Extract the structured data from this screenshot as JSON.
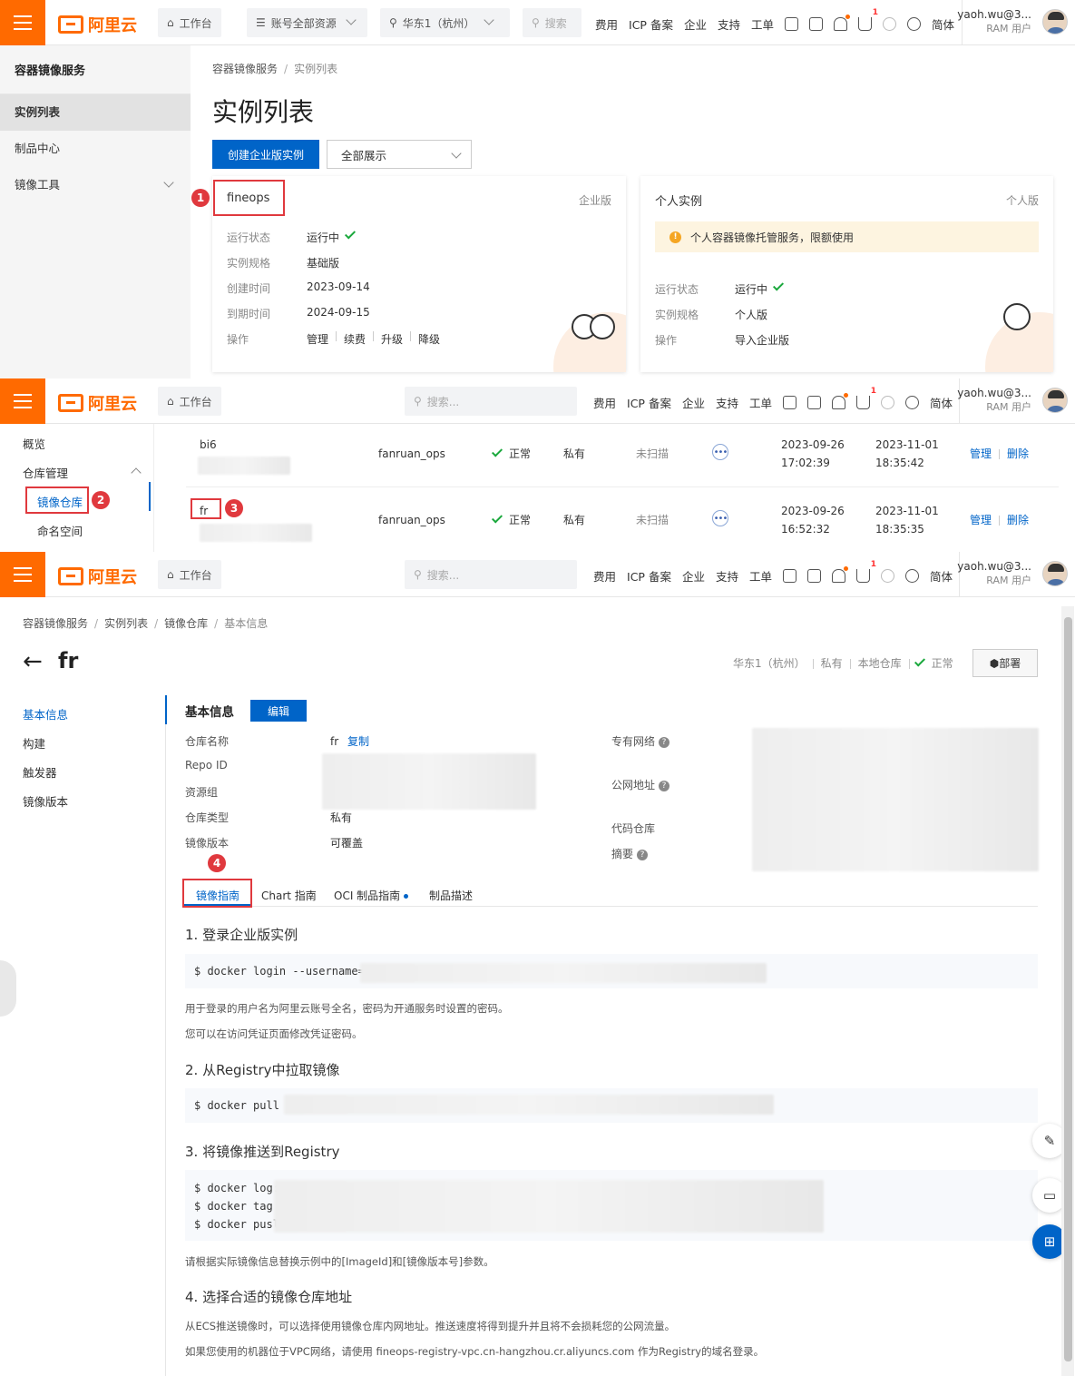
{
  "topbar": {
    "logo": "阿里云",
    "workbench": "工作台",
    "resources": "账号全部资源",
    "region": "华东1（杭州）",
    "search_short": "搜索",
    "search": "搜索...",
    "nav": [
      "费用",
      "ICP 备案",
      "企业",
      "支持",
      "工单"
    ],
    "lang": "简体",
    "cart_badge": "1",
    "user": "yaoh.wu@3...",
    "role": "RAM 用户"
  },
  "s1": {
    "sidebar_title": "容器镜像服务",
    "sidebar_items": [
      "实例列表",
      "制品中心",
      "镜像工具"
    ],
    "breadcrumb": [
      "容器镜像服务",
      "实例列表"
    ],
    "title": "实例列表",
    "create_button": "创建企业版实例",
    "filter": "全部展示",
    "card1": {
      "name": "fineops",
      "tag": "企业版",
      "rows": [
        {
          "k": "运行状态",
          "v": "运行中"
        },
        {
          "k": "实例规格",
          "v": "基础版"
        },
        {
          "k": "创建时间",
          "v": "2023-09-14"
        },
        {
          "k": "到期时间",
          "v": "2024-09-15"
        },
        {
          "k": "操作"
        }
      ],
      "actions": [
        "管理",
        "续费",
        "升级",
        "降级"
      ]
    },
    "card2": {
      "name": "个人实例",
      "tag": "个人版",
      "notice": "个人容器镜像托管服务，限额使用",
      "rows": [
        {
          "k": "运行状态",
          "v": "运行中"
        },
        {
          "k": "实例规格",
          "v": "个人版"
        },
        {
          "k": "操作",
          "v": "导入企业版"
        }
      ]
    }
  },
  "s2": {
    "side_items": [
      "概览",
      "仓库管理",
      "镜像仓库",
      "命名空间"
    ],
    "rows": [
      {
        "name": "bi6",
        "ns": "fanruan_ops",
        "status": "正常",
        "type": "私有",
        "scan": "未扫描",
        "created": [
          "2023-09-26",
          "17:02:39"
        ],
        "updated": [
          "2023-11-01",
          "18:35:42"
        ]
      },
      {
        "name": "fr",
        "ns": "fanruan_ops",
        "status": "正常",
        "type": "私有",
        "scan": "未扫描",
        "created": [
          "2023-09-26",
          "16:52:32"
        ],
        "updated": [
          "2023-11-01",
          "18:35:35"
        ]
      }
    ],
    "actions": [
      "管理",
      "删除"
    ]
  },
  "s3": {
    "breadcrumb": [
      "容器镜像服务",
      "实例列表",
      "镜像仓库",
      "基本信息"
    ],
    "title": "fr",
    "meta": [
      "华东1（杭州）",
      "私有",
      "本地仓库",
      "正常"
    ],
    "deploy": "部署",
    "side_items": [
      "基本信息",
      "构建",
      "触发器",
      "镜像版本"
    ],
    "section_title": "基本信息",
    "edit": "编辑",
    "left_fields": [
      "仓库名称",
      "Repo ID",
      "资源组",
      "仓库类型",
      "镜像版本"
    ],
    "repo_name": "fr",
    "copy": "复制",
    "repo_type": "私有",
    "version": "可覆盖",
    "right_fields": [
      "专有网络",
      "公网地址",
      "代码仓库",
      "摘要"
    ],
    "tabs": [
      "镜像指南",
      "Chart 指南",
      "OCI 制品指南",
      "制品描述"
    ],
    "h1": "1. 登录企业版实例",
    "code1": "$ docker login --username=",
    "p1": "用于登录的用户名为阿里云账号全名，密码为开通服务时设置的密码。",
    "p2": "您可以在访问凭证页面修改凭证密码。",
    "h2": "2. 从Registry中拉取镜像",
    "code2": "$ docker pull",
    "h3": "3. 将镜像推送到Registry",
    "code3": [
      "$ docker log:",
      "$ docker tag",
      "$ docker pusl"
    ],
    "p3": "请根据实际镜像信息替换示例中的[ImageId]和[镜像版本号]参数。",
    "h4": "4. 选择合适的镜像仓库地址",
    "p4": "从ECS推送镜像时，可以选择使用镜像仓库内网地址。推送速度将得到提升并且将不会损耗您的公网流量。",
    "p5": "如果您使用的机器位于VPC网络，请使用 fineops-registry-vpc.cn-hangzhou.cr.aliyuncs.com 作为Registry的域名登录。"
  },
  "steps": [
    "1",
    "2",
    "3",
    "4"
  ]
}
